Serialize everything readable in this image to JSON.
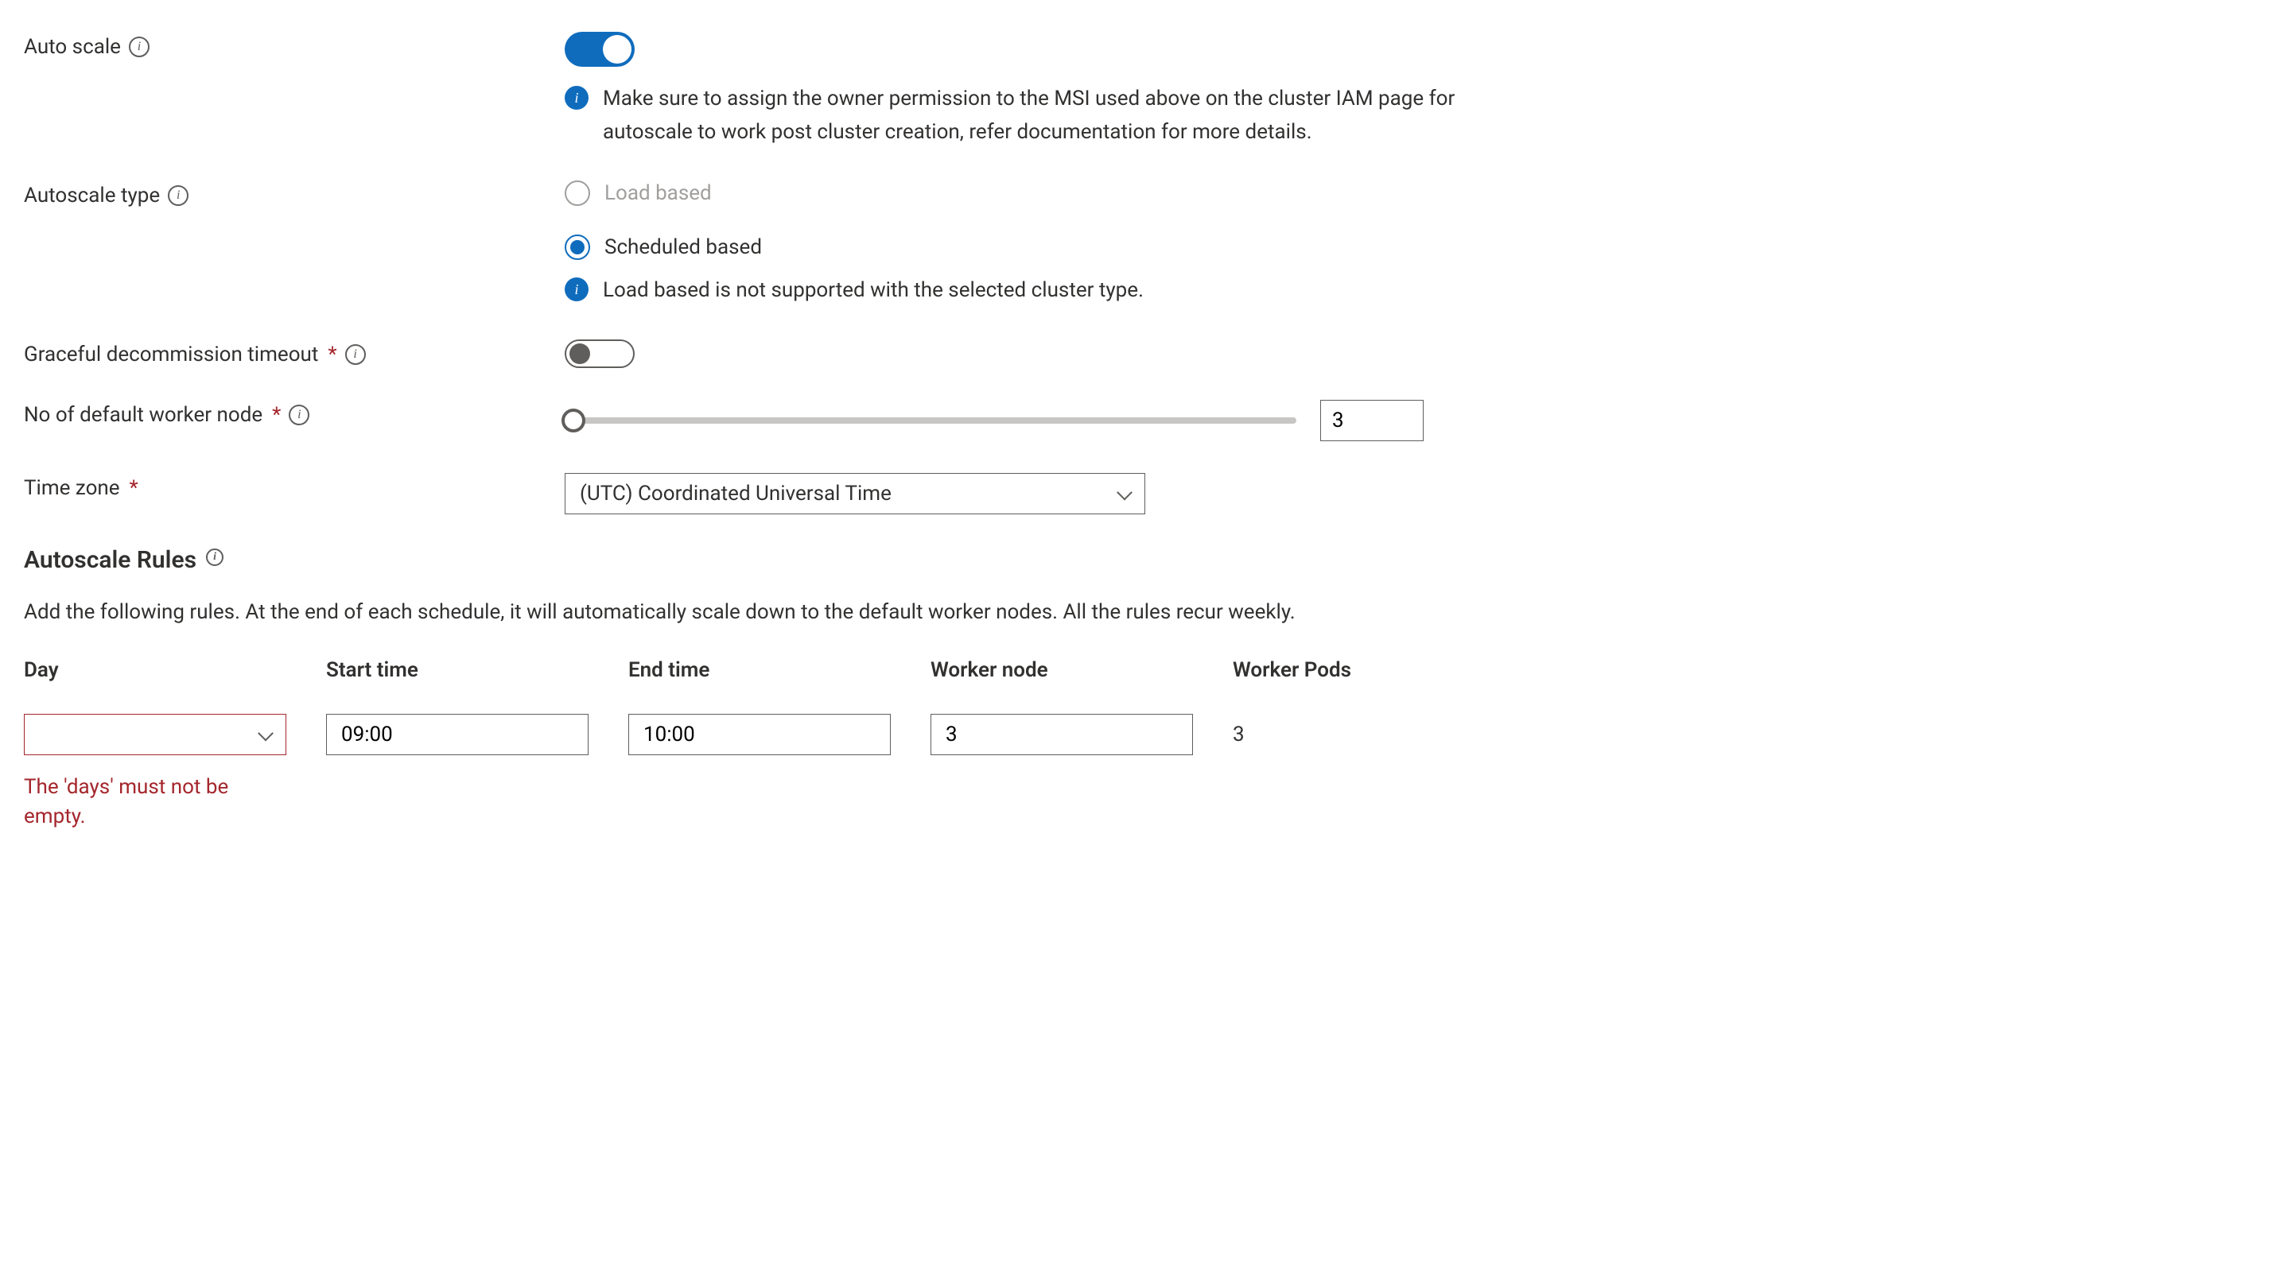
{
  "autoScale": {
    "label": "Auto scale",
    "enabled": true,
    "note": "Make sure to assign the owner permission to the MSI used above on the cluster IAM page for autoscale to work post cluster creation, refer documentation for more details."
  },
  "autoscaleType": {
    "label": "Autoscale type",
    "options": {
      "load": "Load based",
      "scheduled": "Scheduled based"
    },
    "selected": "scheduled",
    "note": "Load based is not supported with the selected cluster type."
  },
  "gracefulDecommission": {
    "label": "Graceful decommission timeout",
    "enabled": false
  },
  "defaultWorkerNode": {
    "label": "No of default worker node",
    "value": "3"
  },
  "timeZone": {
    "label": "Time zone",
    "value": "(UTC) Coordinated Universal Time"
  },
  "rulesSection": {
    "heading": "Autoscale Rules",
    "description": "Add the following rules. At the end of each schedule, it will automatically scale down to the default worker nodes. All the rules recur weekly."
  },
  "rulesTable": {
    "headers": {
      "day": "Day",
      "start": "Start time",
      "end": "End time",
      "node": "Worker node",
      "pods": "Worker Pods"
    },
    "row": {
      "day": "",
      "start": "09:00",
      "end": "10:00",
      "node": "3",
      "pods": "3"
    },
    "dayError": "The 'days' must not be empty."
  }
}
